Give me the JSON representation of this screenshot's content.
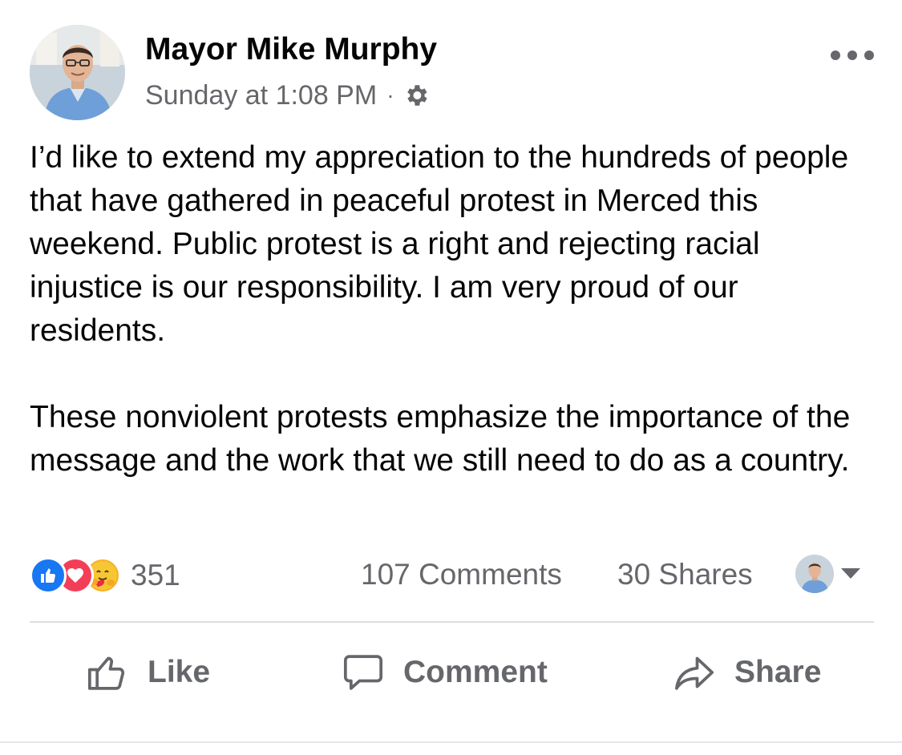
{
  "post": {
    "author": "Mayor Mike Murphy",
    "timestamp": "Sunday at 1:08 PM",
    "separator": "·",
    "privacy_icon": "gear-icon",
    "more_icon": "more-options-icon",
    "paragraphs": [
      "I’d like to extend my appreciation to the hundreds of people that have gathered in peaceful protest in Merced this weekend. Public protest is a right and rejecting racial injustice is our responsibility. I am very proud of our residents.",
      "These nonviolent protests emphasize the importance of the message and the work that we still need to do as a country."
    ]
  },
  "stats": {
    "reactions": [
      "like",
      "love",
      "care"
    ],
    "reaction_count": "351",
    "comments": "107 Comments",
    "shares": "30 Shares"
  },
  "actions": {
    "like": "Like",
    "comment": "Comment",
    "share": "Share"
  },
  "colors": {
    "like_blue": "#1877f2",
    "love_red": "#f33e58",
    "care_yellow": "#f7b125",
    "secondary_text": "#65676b"
  }
}
